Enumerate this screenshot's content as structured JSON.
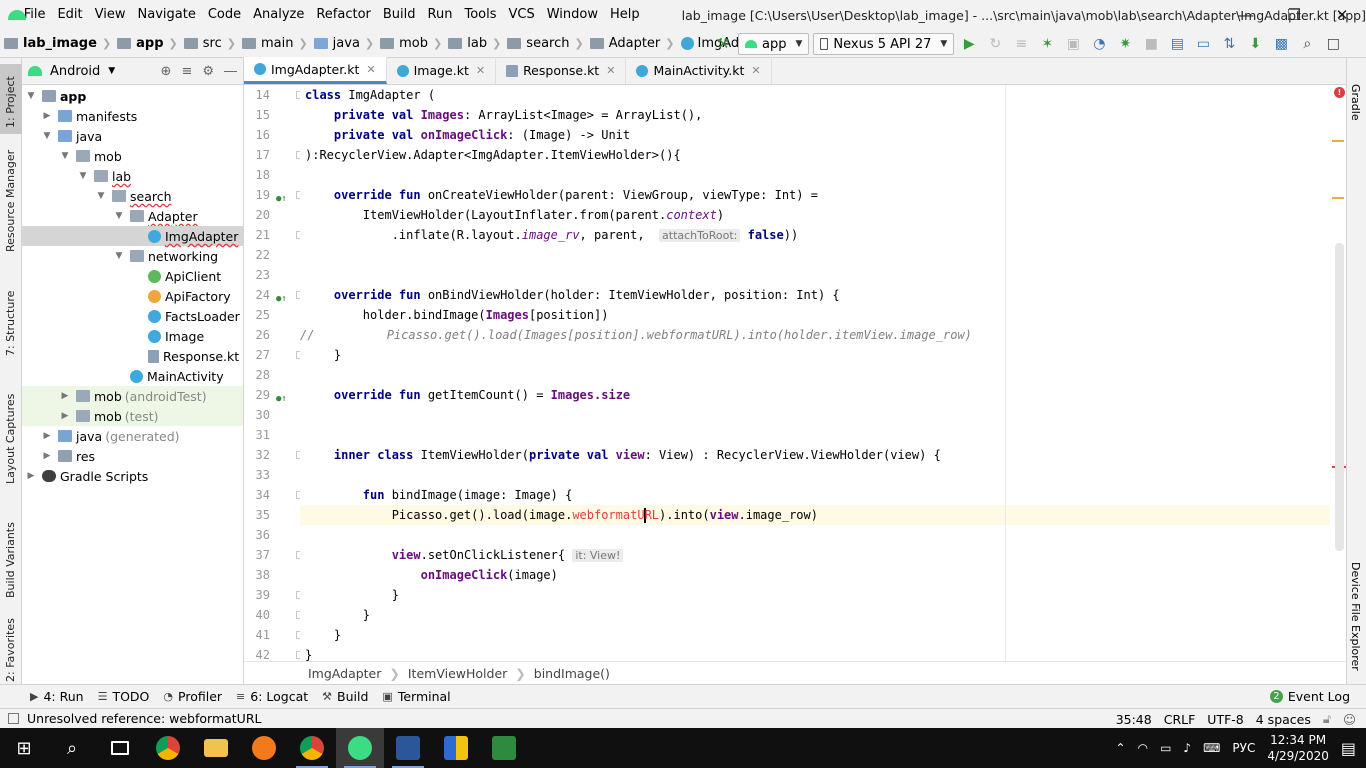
{
  "menu": [
    "File",
    "Edit",
    "View",
    "Navigate",
    "Code",
    "Analyze",
    "Refactor",
    "Build",
    "Run",
    "Tools",
    "VCS",
    "Window",
    "Help"
  ],
  "window_title": "lab_image [C:\\Users\\User\\Desktop\\lab_image] - ...\\src\\main\\java\\mob\\lab\\search\\Adapter\\ImgAdapter.kt [app]",
  "breadcrumbs": [
    "lab_image",
    "app",
    "src",
    "main",
    "java",
    "mob",
    "lab",
    "search",
    "Adapter",
    "ImgAdapter"
  ],
  "run_config": "app",
  "device": "Nexus 5 API 27",
  "project_view": "Android",
  "tree": {
    "app": "app",
    "manifests": "manifests",
    "java": "java",
    "mob": "mob",
    "lab": "lab",
    "search": "search",
    "adapter": "Adapter",
    "imgadapter": "ImgAdapter",
    "networking": "networking",
    "apiclient": "ApiClient",
    "apifactory": "ApiFactory",
    "factsloader": "FactsLoader",
    "image": "Image",
    "response": "Response.kt",
    "mainactivity": "MainActivity",
    "mob_android_test": "mob",
    "mob_android_test_suffix": "(androidTest)",
    "mob_test": "mob",
    "mob_test_suffix": "(test)",
    "java_generated": "java",
    "java_generated_suffix": "(generated)",
    "res": "res",
    "gradle_scripts": "Gradle Scripts"
  },
  "editor_tabs": [
    "ImgAdapter.kt",
    "Image.kt",
    "Response.kt",
    "MainActivity.kt"
  ],
  "code": {
    "line_numbers": [
      "14",
      "15",
      "16",
      "17",
      "18",
      "19",
      "20",
      "21",
      "22",
      "23",
      "24",
      "25",
      "26",
      "27",
      "28",
      "29",
      "30",
      "31",
      "32",
      "33",
      "34",
      "35",
      "36",
      "37",
      "38",
      "39",
      "40",
      "41",
      "42"
    ],
    "l14": "class ImgAdapter (",
    "l15_a": "    private val ",
    "l15_b": "Images",
    "l15_c": ": ArrayList<Image> = ArrayList(),",
    "l16_a": "    private val ",
    "l16_b": "onImageClick",
    "l16_c": ": (Image) -> Unit",
    "l17": "):RecyclerView.Adapter<ImgAdapter.ItemViewHolder>(){",
    "l19_a": "    override fun ",
    "l19_b": "onCreateViewHolder(parent: ViewGroup, viewType: Int) =",
    "l20_a": "        ItemViewHolder(LayoutInflater.from(parent.",
    "l20_b": "context",
    "l20_c": ")",
    "l21_a": "            .inflate(R.layout.",
    "l21_b": "image_rv",
    "l21_c": ", parent,  ",
    "l21_hint": "attachToRoot:",
    "l21_d": " false",
    "l21_e": "))",
    "l24_a": "    override fun ",
    "l24_b": "onBindViewHolder(holder: ItemViewHolder, position: Int) {",
    "l25_a": "        holder.bindImage(",
    "l25_b": "Images",
    "l25_c": "[position])",
    "l26": "//          Picasso.get().load(Images[position].webformatURL).into(holder.itemView.image_row)",
    "l27": "    }",
    "l29_a": "    override fun ",
    "l29_b": "getItemCount() = ",
    "l29_c": "Images",
    "l29_d": ".size",
    "l32_a": "    inner class ",
    "l32_b": "ItemViewHolder(",
    "l32_c": "private val ",
    "l32_d": "view",
    "l32_e": ": View) : RecyclerView.ViewHolder(view) {",
    "l34_a": "        fun ",
    "l34_b": "bindImage(image: Image) {",
    "l35_a": "            Picasso.get().load(image.",
    "l35_b": "webformatU",
    "l35_c": "RL",
    "l35_d": ").into(",
    "l35_e": "view",
    "l35_f": ".image_row)",
    "l37_a": "            ",
    "l37_b": "view",
    "l37_c": ".setOnClickListener{ ",
    "l37_hint": "it: View!",
    "l38_a": "                ",
    "l38_b": "onImageClick",
    "l38_c": "(image)",
    "l39": "            }",
    "l40": "        }",
    "l41": "    }",
    "l42": "}"
  },
  "code_breadcrumb": [
    "ImgAdapter",
    "ItemViewHolder",
    "bindImage()"
  ],
  "left_tabs": [
    "1: Project",
    "Resource Manager",
    "7: Structure",
    "Layout Captures",
    "Build Variants",
    "2: Favorites"
  ],
  "right_tabs": [
    "Gradle",
    "Device File Explorer"
  ],
  "bottom_tools": [
    "4: Run",
    "TODO",
    "Profiler",
    "6: Logcat",
    "Build",
    "Terminal"
  ],
  "event_log": "Event Log",
  "status": {
    "message": "Unresolved reference: webformatURL",
    "position": "35:48",
    "line_sep": "CRLF",
    "encoding": "UTF-8",
    "indent": "4 spaces"
  },
  "taskbar": {
    "lang": "РУС",
    "time": "12:34 PM",
    "date": "4/29/2020"
  },
  "colors": {
    "accent": "#4a88c7",
    "android_green": "#3ddc84",
    "error_red": "#d64040",
    "keyword": "#000080",
    "property": "#660e7a"
  }
}
